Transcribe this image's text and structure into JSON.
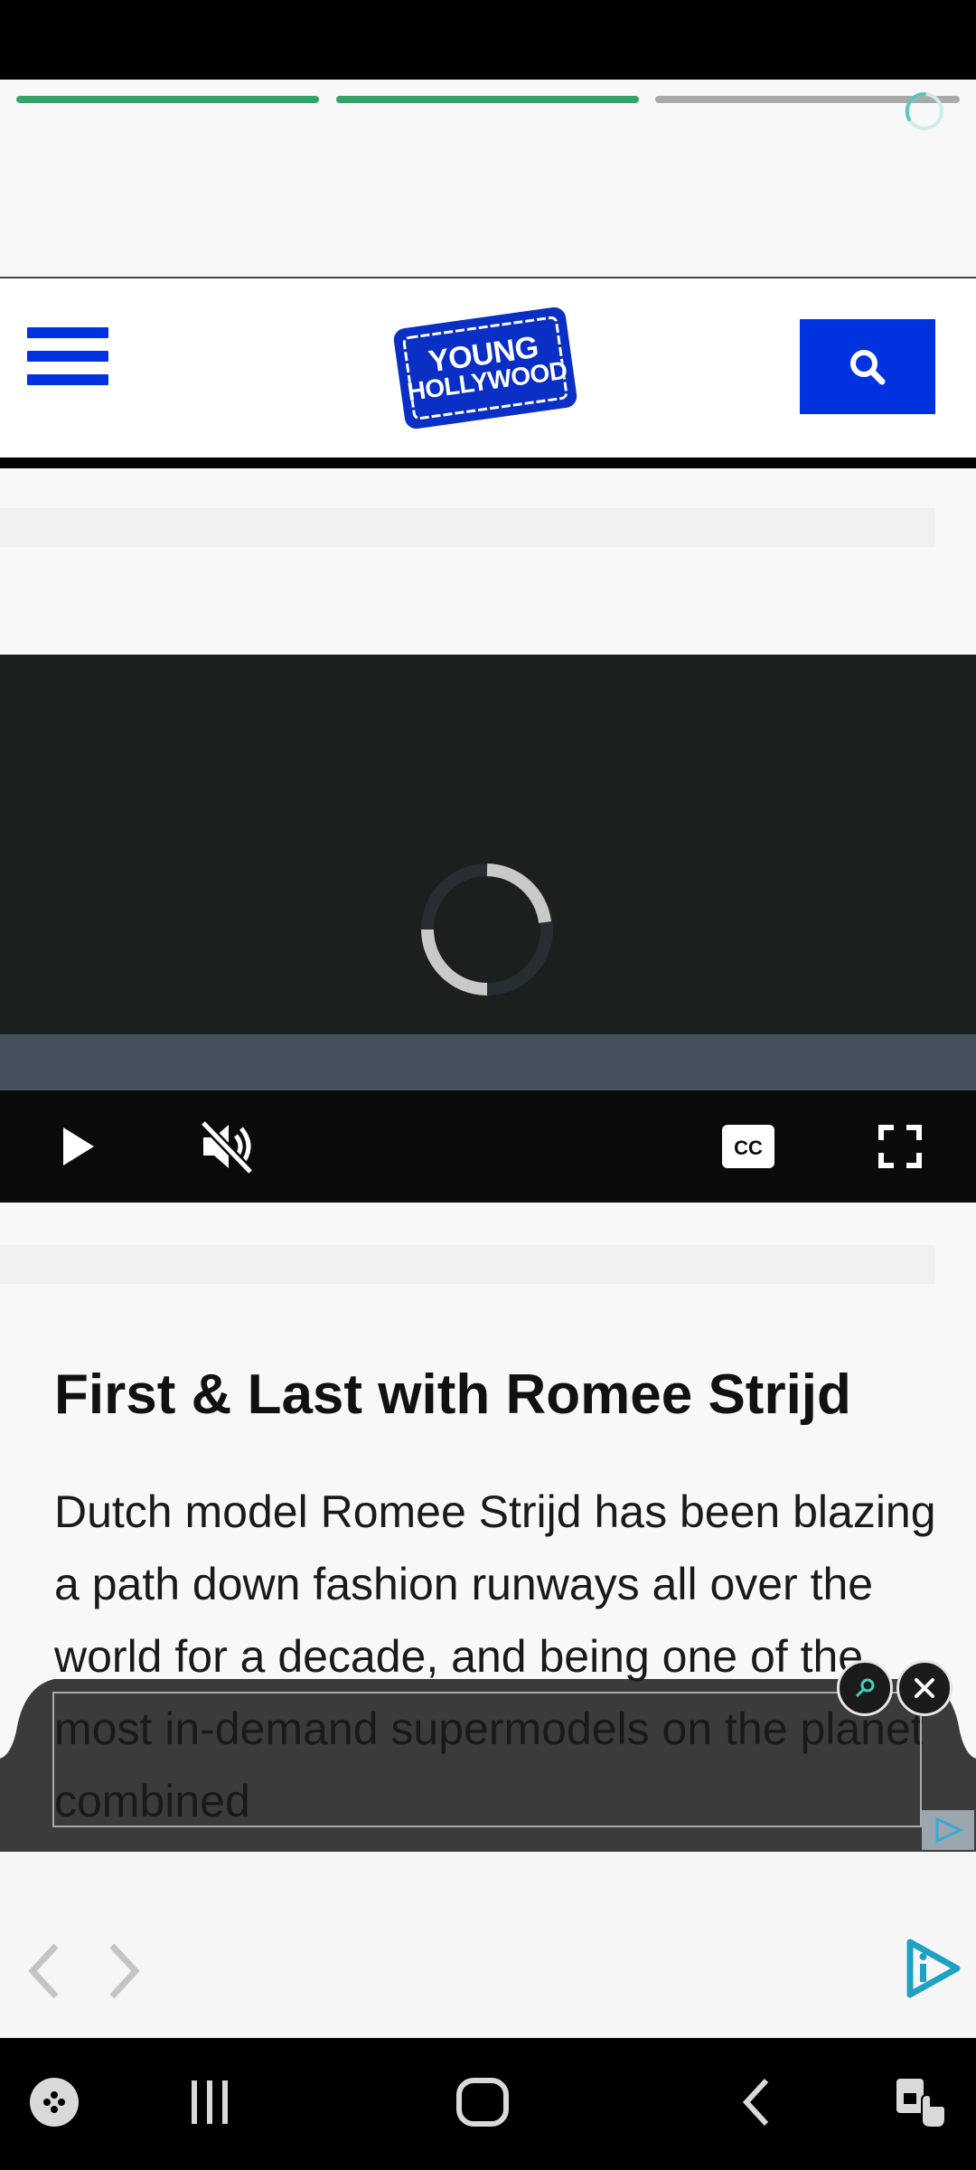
{
  "story_progress": {
    "segments": [
      "complete",
      "complete",
      "pending"
    ],
    "colors": {
      "complete": "#35a368",
      "pending": "#a9a9a9"
    }
  },
  "header": {
    "logo": {
      "line1": "YOUNG",
      "line2": "HOLLYWOOD"
    },
    "menu_icon": "hamburger-icon",
    "search_icon": "search-icon",
    "brand_color": "#0032e0"
  },
  "video": {
    "state": "loading",
    "controls": {
      "play": "play-icon",
      "mute": "volume-muted-icon",
      "captions": "closed-captions-icon",
      "fullscreen": "fullscreen-icon"
    }
  },
  "article": {
    "title": "First & Last with Romee Strijd",
    "body": "Dutch model Romee Strijd has been blazing a path down fashion runways all over the world for a decade, and being one of the most in-demand supermodels on the planet combined"
  },
  "ad": {
    "icons": [
      "ad-expand-icon",
      "close-icon",
      "ad-choices-icon"
    ]
  },
  "browser_bar": {
    "icons": [
      "back-arrow-icon",
      "forward-arrow-icon",
      "app-brand-icon"
    ]
  },
  "system_nav": {
    "icons": [
      "game-launcher-icon",
      "recent-apps-icon",
      "home-icon",
      "back-icon",
      "accessibility-icon"
    ]
  }
}
